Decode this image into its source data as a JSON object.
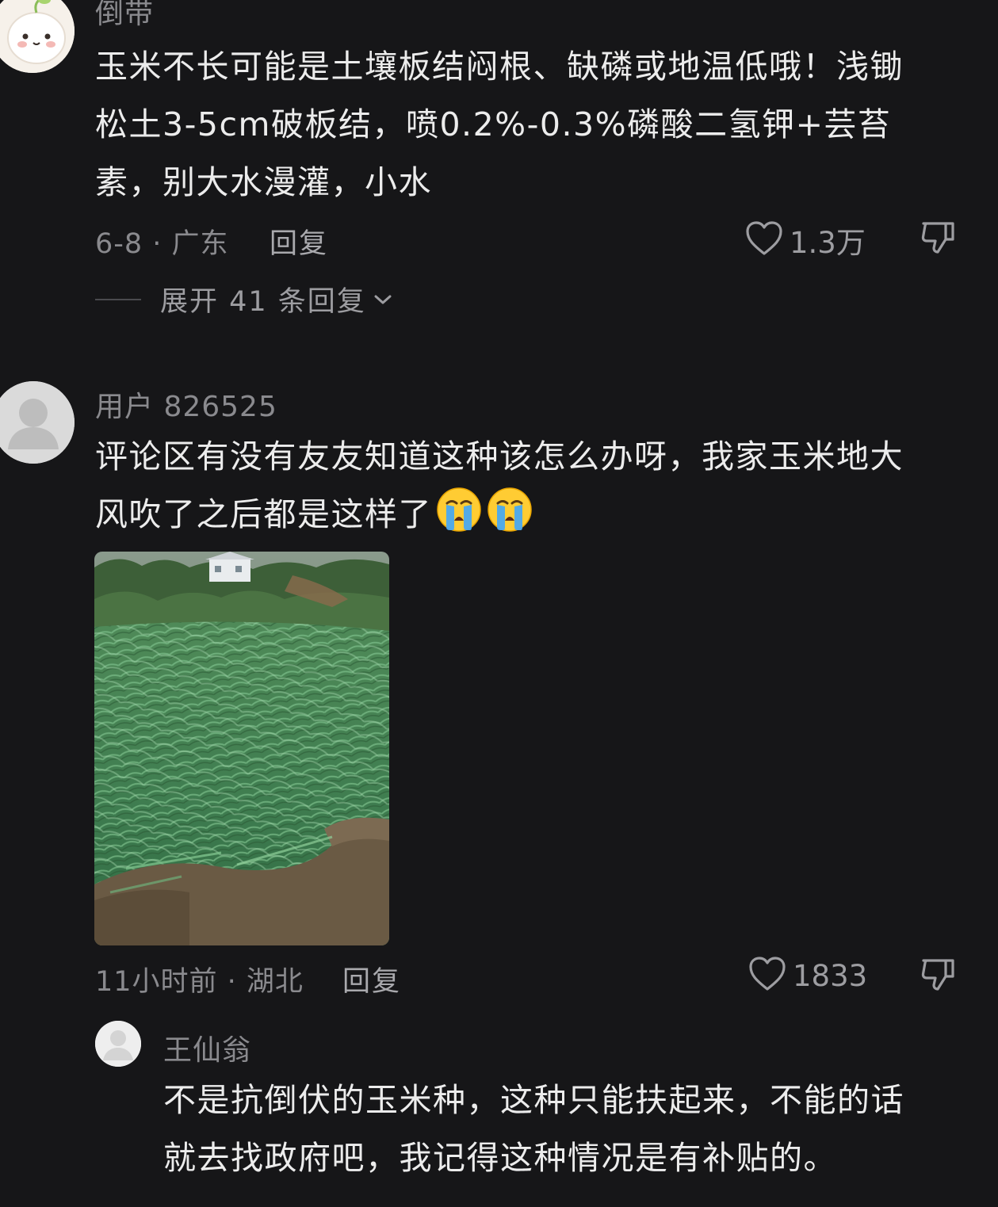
{
  "comments": [
    {
      "username": "倒带",
      "lines": [
        "玉米不长可能是土壤板结闷根、缺磷或地温低哦！浅锄",
        "松土3-5cm破板结，喷0.2%-0.3%磷酸二氢钾+芸苔",
        "素，别大水漫灌，小水"
      ],
      "meta": "6-8 · 广东",
      "reply_label": "回复",
      "likes": "1.3万",
      "expand_label": "展开 41 条回复"
    },
    {
      "username": "用户 826525",
      "lines": [
        "评论区有没有友友知道这种该怎么办呀，我家玉米地大",
        "风吹了之后都是这样了"
      ],
      "emojis": [
        "crying-face",
        "crying-face"
      ],
      "photo_caption": "flattened corn field after strong wind",
      "meta": "11小时前 · 湖北",
      "reply_label": "回复",
      "likes": "1833"
    }
  ],
  "reply": {
    "username": "王仙翁",
    "lines": [
      "不是抗倒伏的玉米种，这种只能扶起来，不能的话",
      "就去找政府吧，我记得这种情况是有补贴的。"
    ]
  },
  "icons": {
    "like": "heart-outline-icon",
    "dislike": "thumbs-down-outline-icon",
    "expand": "chevron-down-icon"
  },
  "colors": {
    "background": "#161618",
    "text": "#ececec",
    "muted": "#8a8a8e"
  }
}
